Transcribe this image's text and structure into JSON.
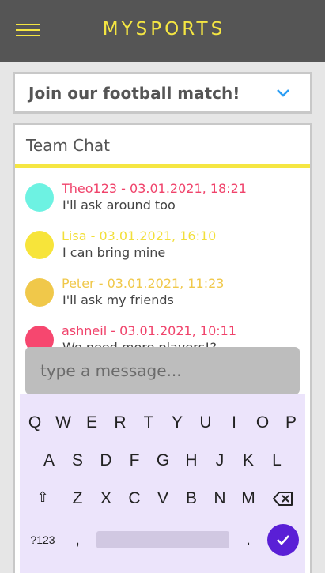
{
  "appbar": {
    "title": "MYSPORTS",
    "menu_icon": "hamburger-menu-icon"
  },
  "event_select": {
    "selected": "Join our football match!",
    "chevron_icon": "chevron-down-icon"
  },
  "chat": {
    "title": "Team Chat",
    "messages": [
      {
        "meta": "Theo123 - 03.01.2021, 18:21",
        "text": "I'll ask around too",
        "avatar_color": "#6df2e2",
        "meta_color": "#f0436b"
      },
      {
        "meta": "Lisa - 03.01.2021, 16:10",
        "text": "I can bring mine",
        "avatar_color": "#f7e43a",
        "meta_color": "#f2df3a"
      },
      {
        "meta": "Peter - 03.01.2021, 11:23",
        "text": "I'll ask my friends",
        "avatar_color": "#f0c84a",
        "meta_color": "#f0c84a"
      },
      {
        "meta": "ashneil - 03.01.2021, 10:11",
        "text": "We need more players!?",
        "avatar_color": "#f6476f",
        "meta_color": "#f0436b"
      }
    ]
  },
  "composer": {
    "placeholder": "type a message..."
  },
  "keyboard": {
    "row1": [
      "Q",
      "W",
      "E",
      "R",
      "T",
      "Y",
      "U",
      "I",
      "O",
      "P"
    ],
    "row2": [
      "A",
      "S",
      "D",
      "F",
      "G",
      "H",
      "J",
      "K",
      "L"
    ],
    "row3": [
      "Z",
      "X",
      "C",
      "V",
      "B",
      "N",
      "M"
    ],
    "shift_label": "⇧",
    "symbols_label": "?123",
    "comma_label": ",",
    "period_label": ".",
    "backspace_icon": "backspace-icon",
    "send_icon": "checkmark-icon"
  },
  "colors": {
    "accent_yellow": "#f5e642",
    "appbar_bg": "#555555",
    "send_purple": "#5a1fd6",
    "keyboard_bg": "#ece4fb"
  }
}
